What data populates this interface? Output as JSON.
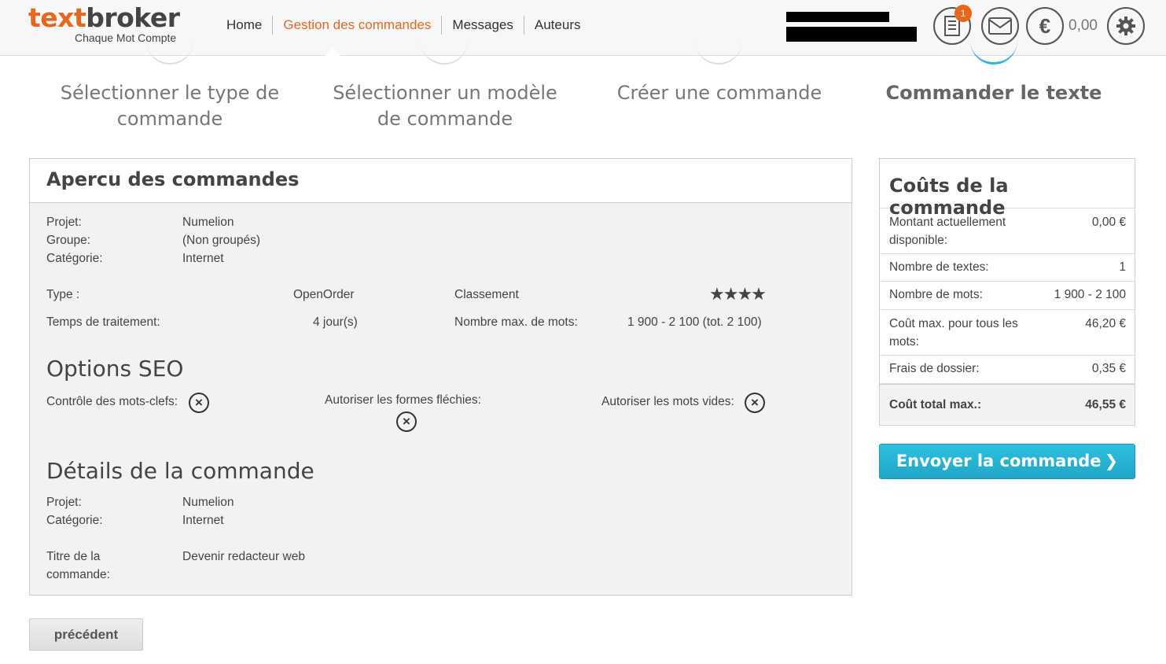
{
  "header": {
    "logo_text_1": "text",
    "logo_text_2": "broker",
    "logo_tagline": "Chaque Mot Compte",
    "nav": [
      "Home",
      "Gestion des commandes",
      "Messages",
      "Auteurs"
    ],
    "notification_count": "1",
    "balance": "0,00",
    "icons": [
      "orders-icon",
      "mail-icon",
      "euro-icon",
      "gear-icon"
    ]
  },
  "steps": [
    {
      "label": "Sélectionner le type de commande",
      "active": false
    },
    {
      "label": "Sélectionner un modèle de commande",
      "active": false
    },
    {
      "label": "Créer une commande",
      "active": false
    },
    {
      "label": "Commander le texte",
      "active": true
    }
  ],
  "overview": {
    "title": "Apercu des commandes",
    "projet_label": "Projet:",
    "projet_value": "Numelion",
    "groupe_label": "Groupe:",
    "groupe_value": "(Non groupés)",
    "categorie_label": "Catégorie:",
    "categorie_value": "Internet",
    "type_label": "Type :",
    "type_value": "OpenOrder",
    "classement_label": "Classement",
    "classement_stars": 4,
    "temps_label": "Temps de traitement:",
    "temps_value": "4 jour(s)",
    "mots_label": "Nombre max. de mots:",
    "mots_value": "1 900 - 2 100 (tot. 2 100)",
    "seo_title": "Options SEO",
    "seo_keywords": "Contrôle des mots-clefs:",
    "seo_inflected": "Autoriser les formes fléchies:",
    "seo_stopwords": "Autoriser les mots vides:",
    "details_title": "Détails de la commande",
    "d_projet_label": "Projet:",
    "d_projet_value": "Numelion",
    "d_categorie_label": "Catégorie:",
    "d_categorie_value": "Internet",
    "d_titre_label_1": "Titre de la",
    "d_titre_label_2": "commande:",
    "d_titre_value": "Devenir redacteur web"
  },
  "costs": {
    "title": "Coûts de la commande",
    "rows": [
      {
        "label": "Montant actuellement disponible:",
        "value": "0,00 €"
      },
      {
        "label": "Nombre de textes:",
        "value": "1"
      },
      {
        "label": "Nombre de mots:",
        "value": "1 900 - 2 100"
      },
      {
        "label": "Coût max. pour tous les mots:",
        "value": "46,20 €"
      },
      {
        "label": "Frais de dossier:",
        "value": "0,35 €"
      }
    ],
    "total_label": "Coût total max.:",
    "total_value": "46,55 €"
  },
  "buttons": {
    "send": "Envoyer la commande",
    "prev": "précédent"
  },
  "colors": {
    "brand_orange": "#e8671c",
    "accent_blue": "#2bb8d8"
  }
}
